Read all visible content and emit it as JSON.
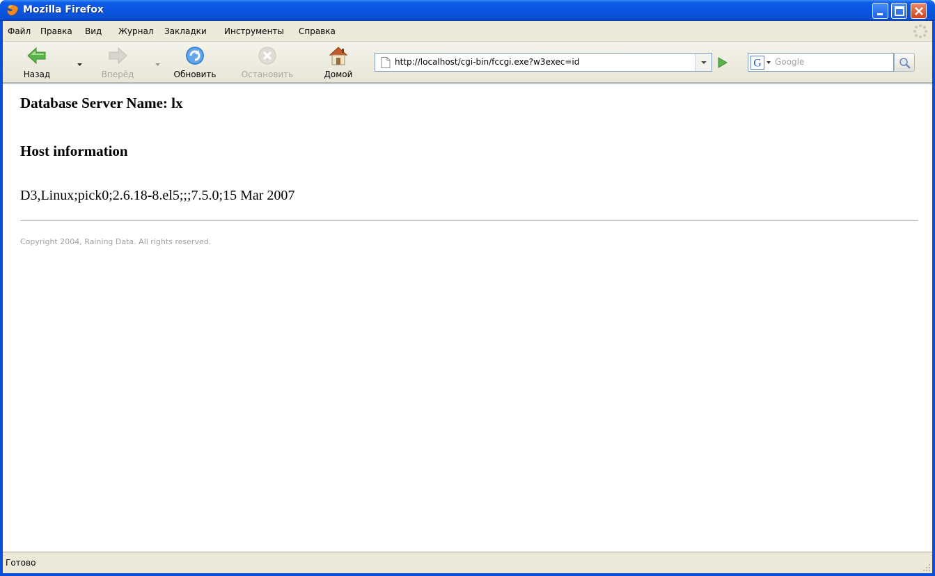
{
  "window": {
    "title": "Mozilla Firefox"
  },
  "menu": {
    "items": [
      {
        "label": "Файл"
      },
      {
        "label": "Правка"
      },
      {
        "label": "Вид"
      },
      {
        "label": "Журнал"
      },
      {
        "label": "Закладки"
      },
      {
        "label": "Инструменты"
      },
      {
        "label": "Справка"
      }
    ]
  },
  "toolbar": {
    "back_label": "Назад",
    "forward_label": "Вперёд",
    "reload_label": "Обновить",
    "stop_label": "Остановить",
    "home_label": "Домой",
    "url": "http://localhost/cgi-bin/fccgi.exe?w3exec=id",
    "search_placeholder": "Google"
  },
  "page": {
    "server_heading": "Database Server Name: lx",
    "host_heading": "Host information",
    "host_info": "D3,Linux;pick0;2.6.18-8.el5;;;7.5.0;15 Mar 2007",
    "copyright": "Copyright 2004, Raining Data. All rights reserved."
  },
  "status": {
    "text": "Готово"
  },
  "colors": {
    "titlebar": "#0a55e0",
    "chrome": "#ece9d8",
    "accent_green": "#5bb44a"
  },
  "icons": {
    "app": "firefox-icon",
    "back": "back-arrow-icon",
    "forward": "forward-arrow-icon",
    "reload": "reload-icon",
    "stop": "stop-icon",
    "home": "home-icon",
    "go": "go-arrow-icon",
    "search": "magnifier-icon"
  }
}
